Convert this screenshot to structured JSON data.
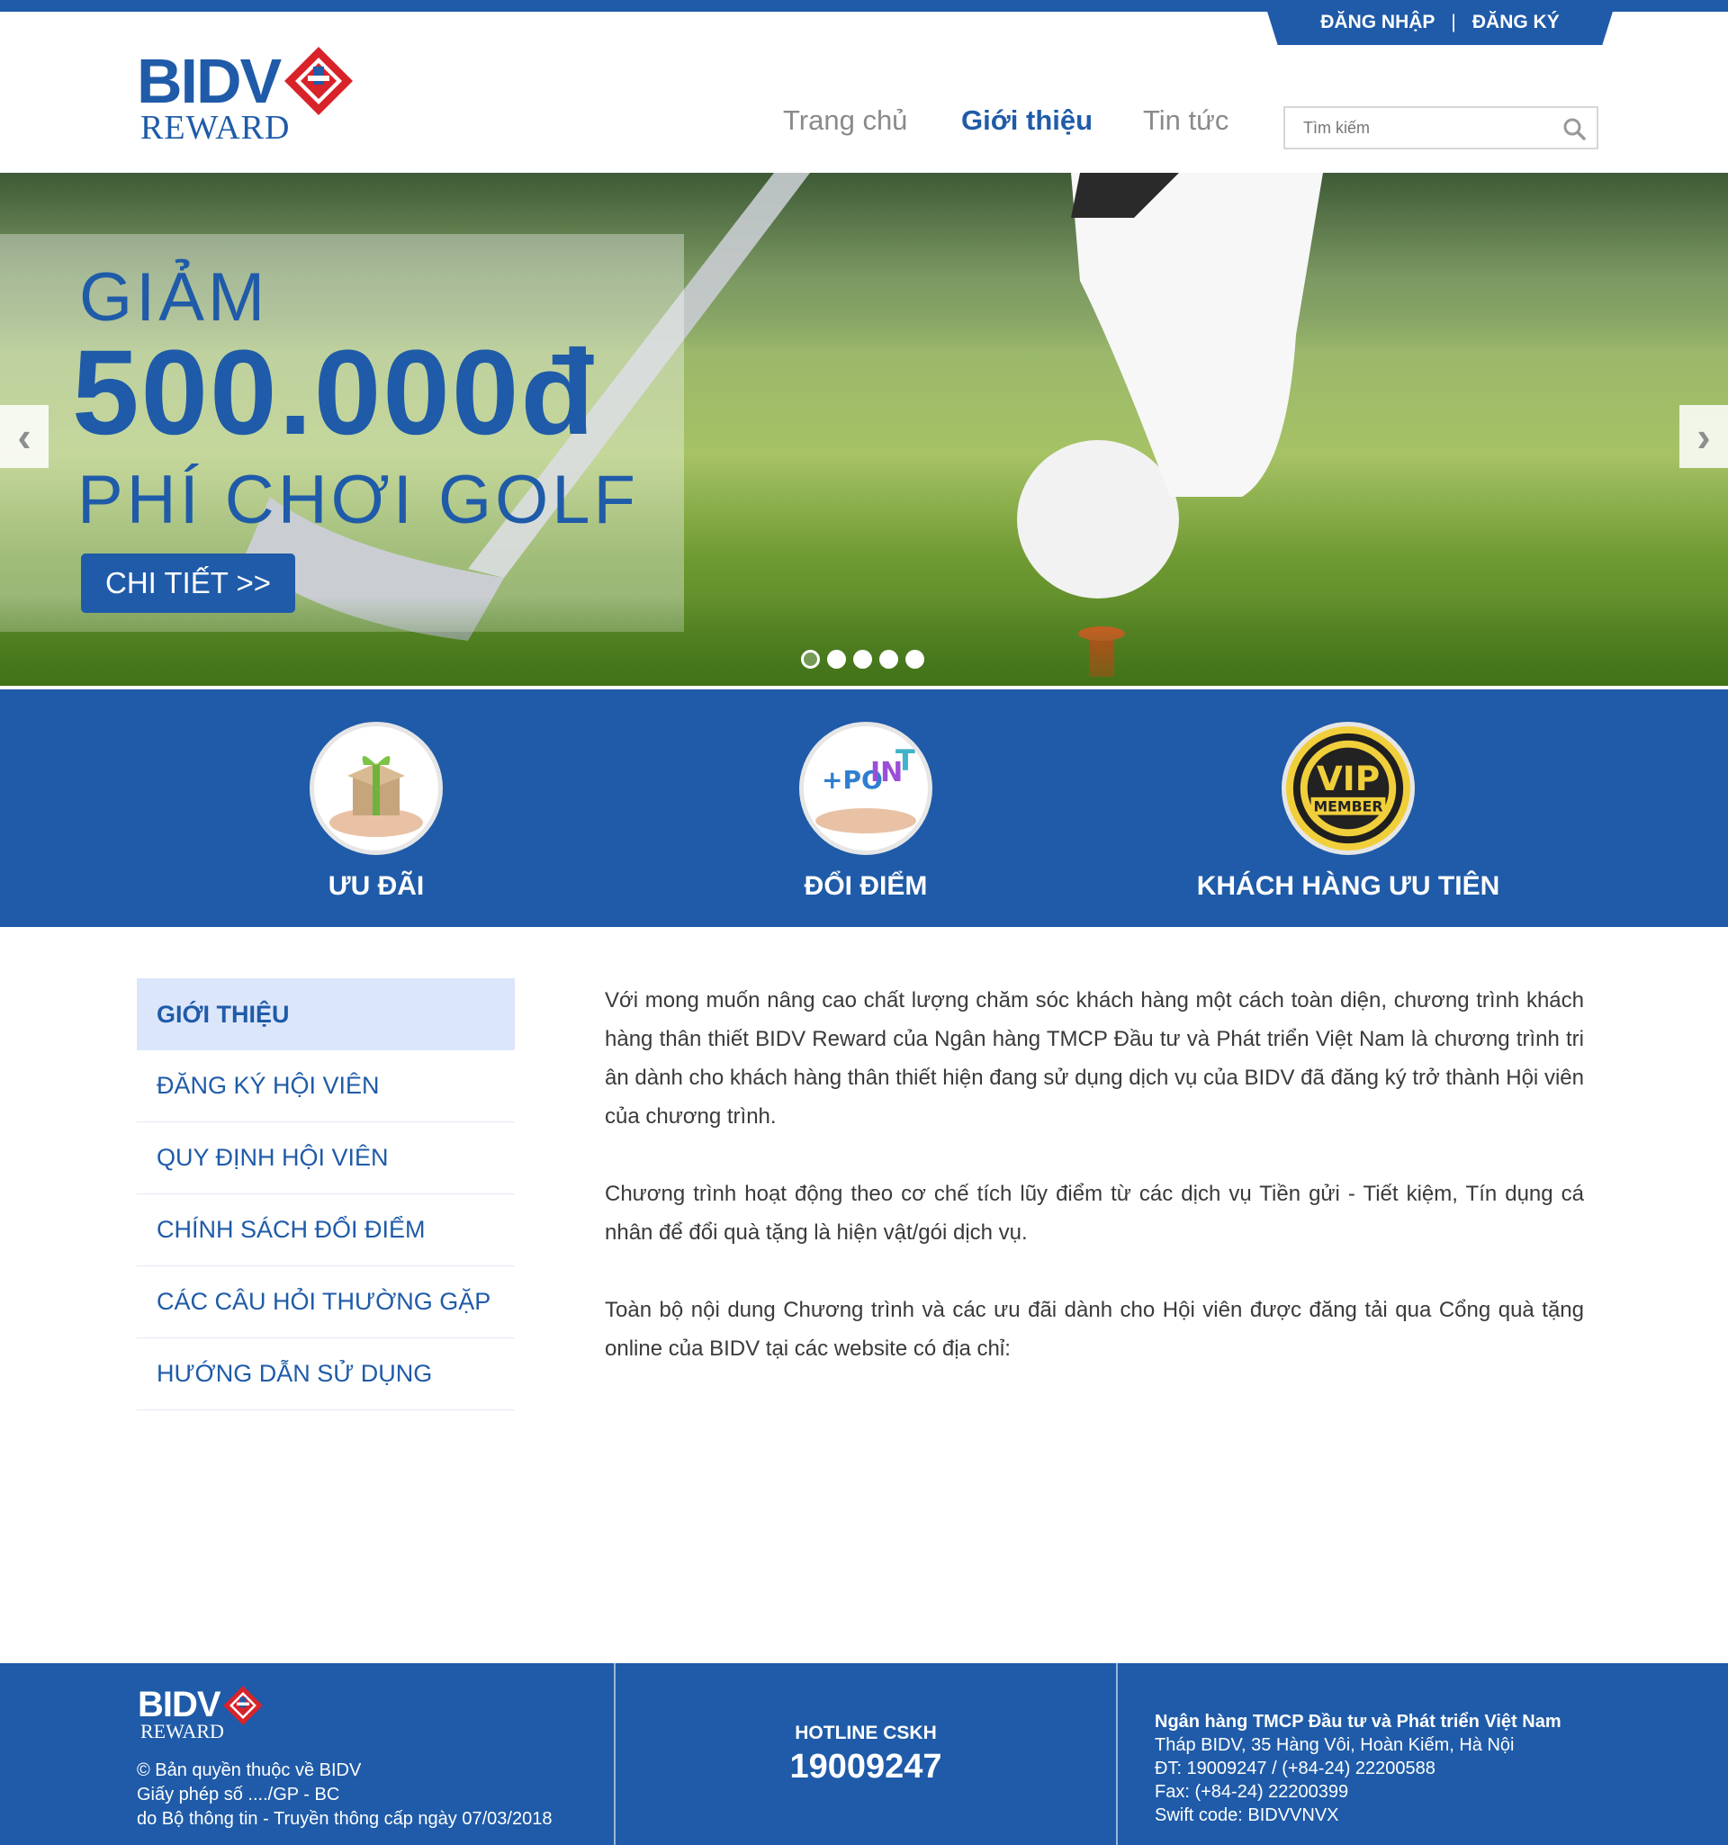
{
  "auth": {
    "login": "ĐĂNG NHẬP",
    "separator": "|",
    "register": "ĐĂNG KÝ"
  },
  "logo": {
    "brand": "BIDV",
    "sub": "REWARD"
  },
  "nav": [
    {
      "label": "Trang chủ",
      "active": false
    },
    {
      "label": "Giới thiệu",
      "active": true
    },
    {
      "label": "Tin tức",
      "active": false
    }
  ],
  "search": {
    "placeholder": "Tìm kiếm"
  },
  "banner": {
    "line1": "GIẢM",
    "amount": "500.000đ",
    "line3": "PHÍ CHƠI GOLF",
    "cta": "CHI TIẾT >>",
    "prev": "‹",
    "next": "›",
    "slides": 5,
    "active_slide": 1
  },
  "features": [
    {
      "label": "ƯU ĐÃI",
      "icon": "gift-icon"
    },
    {
      "label": "ĐỔI ĐIỂM",
      "icon": "point-icon"
    },
    {
      "label": "KHÁCH HÀNG ƯU TIÊN",
      "icon": "vip-icon",
      "badge_top": "VIP",
      "badge_bottom": "MEMBER"
    }
  ],
  "sidebar": [
    {
      "label": "GIỚI THIỆU",
      "active": true
    },
    {
      "label": "ĐĂNG KÝ HỘI VIÊN",
      "active": false
    },
    {
      "label": "QUY ĐỊNH HỘI VIÊN",
      "active": false
    },
    {
      "label": "CHÍNH SÁCH ĐỔI ĐIỂM",
      "active": false
    },
    {
      "label": "CÁC CÂU HỎI THƯỜNG GẶP",
      "active": false
    },
    {
      "label": "HƯỚNG DẪN SỬ DỤNG",
      "active": false
    }
  ],
  "content": {
    "paragraphs": [
      "Với mong muốn nâng cao chất lượng chăm sóc khách hàng một cách toàn diện, chương trình khách hàng thân thiết BIDV Reward của Ngân hàng TMCP Đầu tư và Phát triển Việt Nam là chương trình tri ân dành cho khách hàng thân thiết hiện đang sử dụng dịch vụ của BIDV đã đăng ký trở thành Hội viên của chương trình.",
      "Chương trình hoạt động theo cơ chế tích lũy điểm từ các dịch vụ Tiền gửi - Tiết kiệm, Tín dụng cá nhân để đổi quà tặng là hiện vật/gói dịch vụ.",
      "Toàn bộ nội dung Chương trình và các ưu đãi dành cho Hội viên được đăng tải qua Cổng quà tặng online của BIDV tại các website có địa chỉ:"
    ]
  },
  "footer": {
    "copyright": "© Bản quyền thuộc về BIDV",
    "license": "Giấy phép số ..../GP - BC",
    "issuer": "do Bộ thông tin - Truyền thông cấp ngày 07/03/2018",
    "hotline_label": "HOTLINE CSKH",
    "hotline": "19009247",
    "bank": "Ngân hàng TMCP Đầu tư và Phát triển Việt Nam",
    "address": "Tháp BIDV, 35 Hàng Vôi, Hoàn Kiếm, Hà Nội",
    "phone": "ĐT: 19009247 / (+84-24) 22200588",
    "fax": "Fax: (+84-24) 22200399",
    "swift": "Swift code: BIDVVNVX"
  },
  "colors": {
    "brand": "#1f5ba8",
    "active_bg": "#dce6fb",
    "logo_red": "#d8232a"
  }
}
